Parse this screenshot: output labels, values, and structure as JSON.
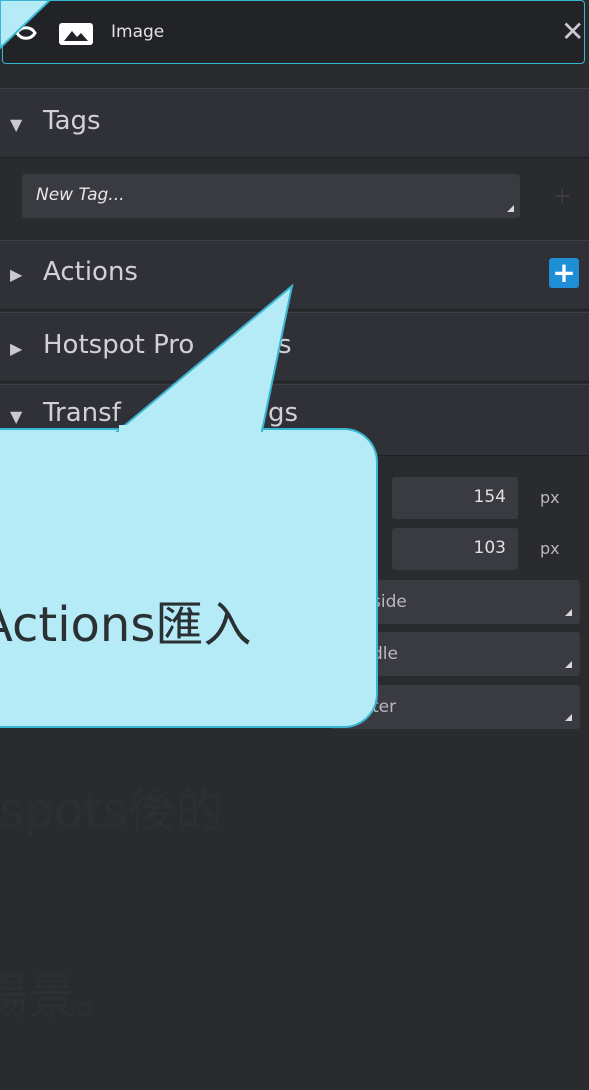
{
  "header": {
    "title": "Image",
    "close_symbol": "✕"
  },
  "sections": {
    "tags": {
      "label": "Tags",
      "state": "expanded"
    },
    "actions": {
      "label": "Actions",
      "state": "collapsed"
    },
    "hotspot": {
      "label": "Hotspot Pro",
      "label_tail": "es",
      "state": "collapsed"
    },
    "transform": {
      "label": "Transf",
      "label_tail": "gs",
      "state": "expanded"
    }
  },
  "tags_input": {
    "placeholder": "New Tag..."
  },
  "actions_add": {
    "symbol": "+"
  },
  "transform_fields": {
    "field1": {
      "value": "154",
      "unit": "px"
    },
    "field2": {
      "value": "103",
      "unit": "px"
    },
    "dropdown1": "side",
    "dropdown2": "dle",
    "dropdown3": "ter"
  },
  "callout": {
    "line1": "Actions匯入",
    "line2": "tspots後的",
    "line3": "場景。"
  },
  "colors": {
    "accent": "#39b6d3",
    "button_blue": "#1e8fd6",
    "callout_fill": "#b5ebf6"
  }
}
